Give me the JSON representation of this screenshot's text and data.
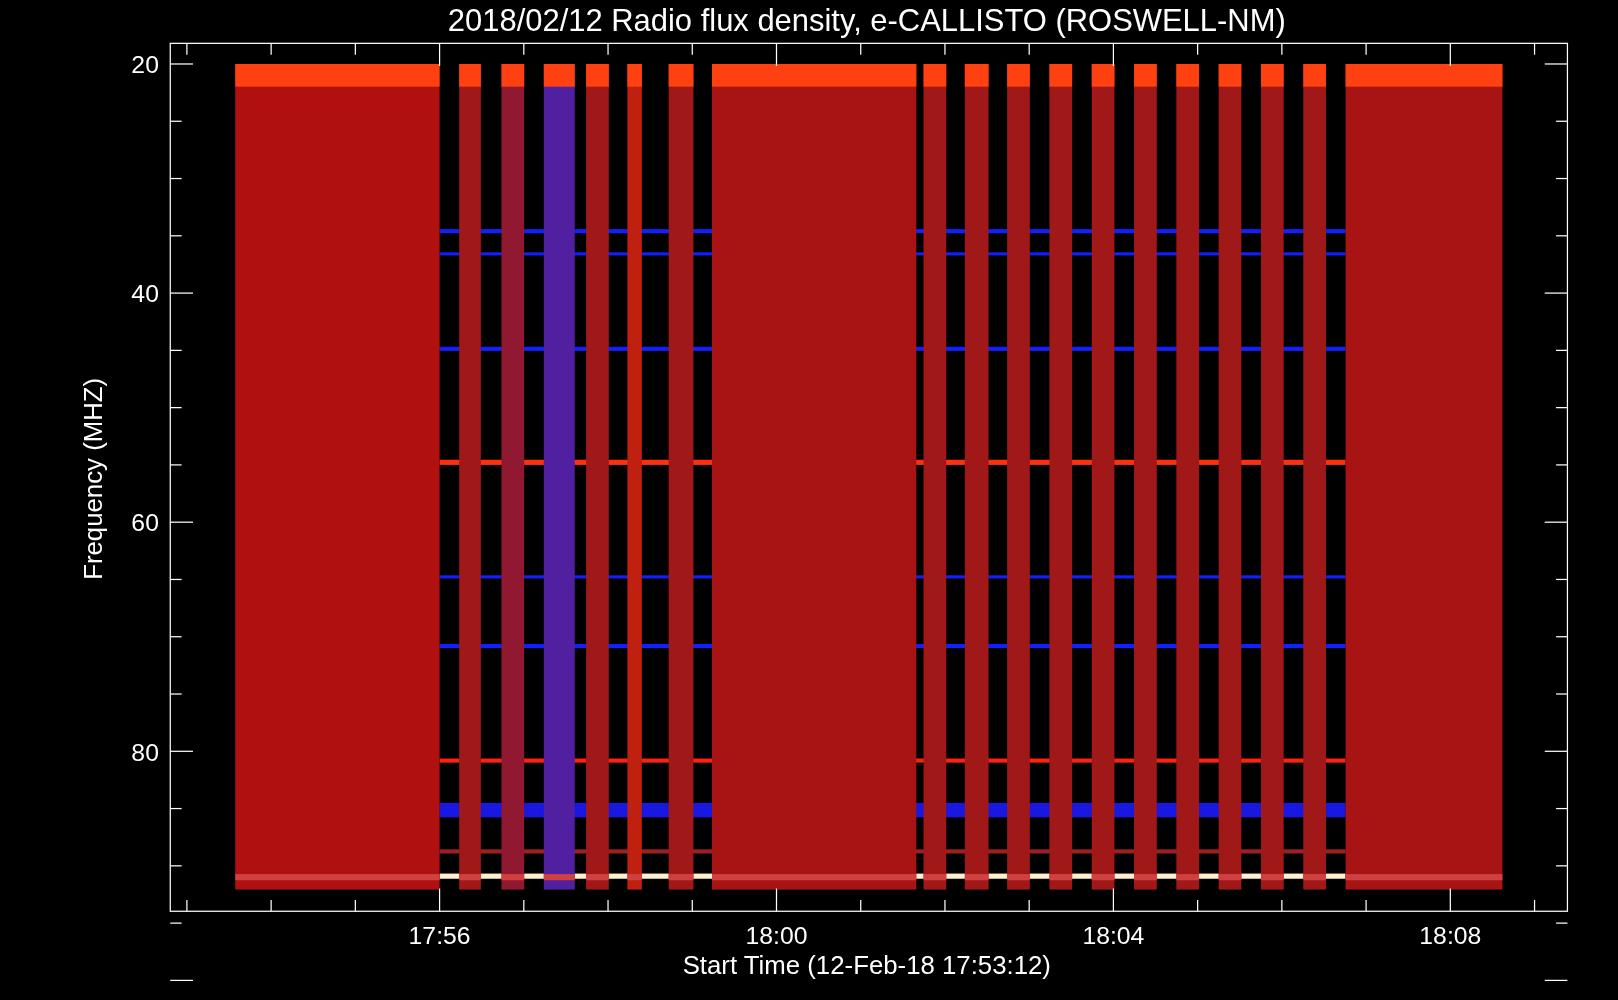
{
  "plot": {
    "title": "2018/02/12  Radio flux density, e-CALLISTO (ROSWELL-NM)",
    "xlabel": "Start Time (12-Feb-18 17:53:12)",
    "ylabel": "Frequency (MHZ)",
    "xtick_labels": [
      "17:56",
      "18:00",
      "18:04",
      "18:08"
    ],
    "ytick_labels": [
      "20",
      "40",
      "60",
      "80"
    ]
  }
}
